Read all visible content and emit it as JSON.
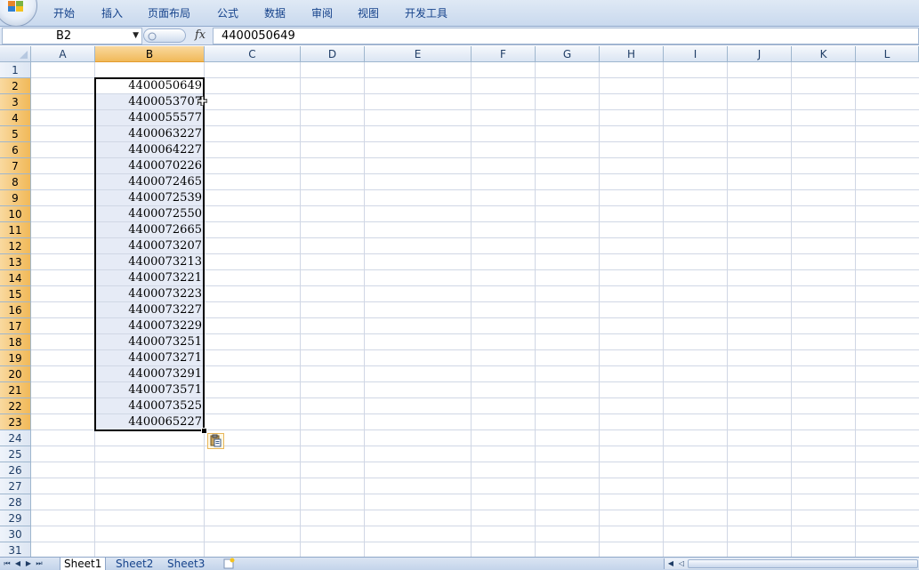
{
  "ribbon": {
    "tabs": [
      "开始",
      "插入",
      "页面布局",
      "公式",
      "数据",
      "审阅",
      "视图",
      "开发工具"
    ]
  },
  "formula_bar": {
    "name_box": "B2",
    "fx_label": "fx",
    "formula_value": "4400050649"
  },
  "grid": {
    "columns": [
      "A",
      "B",
      "C",
      "D",
      "E",
      "F",
      "G",
      "H",
      "I",
      "J",
      "K",
      "L"
    ],
    "selected_column": "B",
    "rows": [
      "1",
      "2",
      "3",
      "4",
      "5",
      "6",
      "7",
      "8",
      "9",
      "10",
      "11",
      "12",
      "13",
      "14",
      "15",
      "16",
      "17",
      "18",
      "19",
      "20",
      "21",
      "22",
      "23",
      "24",
      "25",
      "26",
      "27",
      "28",
      "29",
      "30",
      "31"
    ],
    "selected_rows_range": [
      "2",
      "23"
    ],
    "column_b_values": [
      "4400050649",
      "4400053707",
      "4400055577",
      "4400063227",
      "4400064227",
      "4400070226",
      "4400072465",
      "4400072539",
      "4400072550",
      "4400072665",
      "4400073207",
      "4400073213",
      "4400073221",
      "4400073223",
      "4400073227",
      "4400073229",
      "4400073251",
      "4400073271",
      "4400073291",
      "4400073571",
      "4400073525",
      "4400065227"
    ]
  },
  "sheets": {
    "tabs": [
      "Sheet1",
      "Sheet2",
      "Sheet3"
    ],
    "active": "Sheet1"
  },
  "colors": {
    "selection_fill": "#e6ebf6",
    "header_highlight": "#f1b959",
    "ribbon_text": "#15428b"
  }
}
